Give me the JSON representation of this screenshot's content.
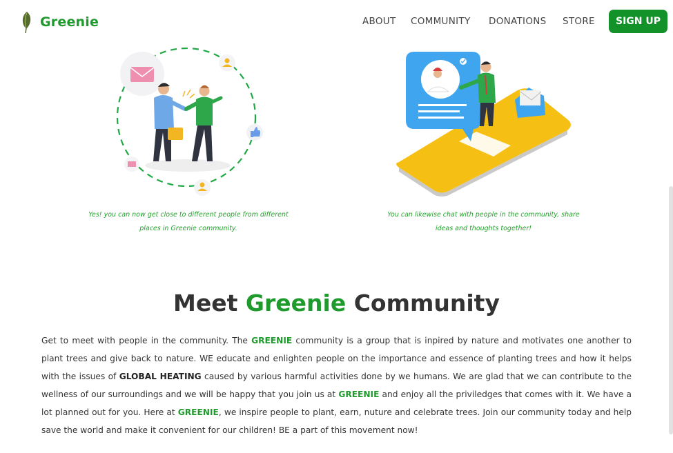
{
  "brand": {
    "name": "Greenie",
    "logo_icon": "leaf-icon"
  },
  "nav": {
    "links": [
      "ABOUT",
      "COMMUNITY",
      "DONATIONS",
      "STORE"
    ],
    "signup_label": "SIGN UP"
  },
  "features": [
    {
      "icon": "handshake-illustration",
      "caption": "Yes! you can now get close to different people from different places in Greenie community."
    },
    {
      "icon": "phone-chat-illustration",
      "caption": "You can likewise chat with people in the community, share ideas and thoughts together!"
    }
  ],
  "section": {
    "title_part1": "Meet",
    "title_highlight": "Greenie",
    "title_part2": "Community",
    "paragraph": [
      "Get to meet with people in the community. The ",
      "GREENIE",
      " community is a group that is inpired by nature and motivates one another to plant trees and give back to nature. WE educate and enlighten people on the importance and essence of planting trees and how it helps with the issues of ",
      "GLOBAL HEATING",
      " caused by various harmful activities done by we humans. We are glad that we can contribute to the wellness of our surroundings and we will be happy that you join us at ",
      "GREENIE",
      " and enjoy all the priviledges that comes with it. We have a lot planned out for you. Here at ",
      "GREENIE",
      ", we inspire people to plant, earn, nuture and celebrate trees. Join our community today and help save the world and make it convenient for our children! BE a part of this movement now!"
    ]
  },
  "colors": {
    "brand_green": "#1f9a2c",
    "button_green": "#14922a",
    "phone_yellow": "#f6bf14",
    "chat_blue": "#3fa5ee"
  }
}
